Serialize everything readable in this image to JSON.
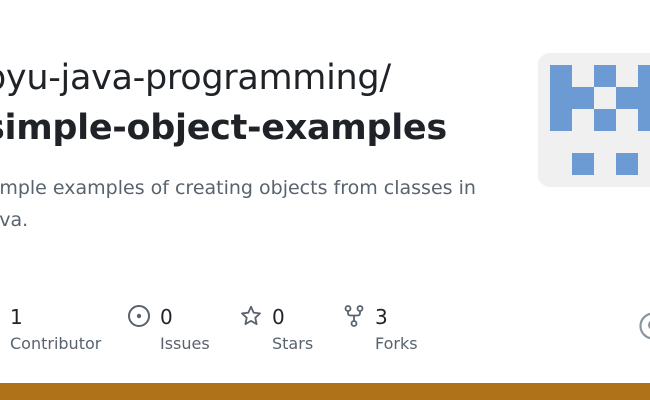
{
  "repo": {
    "owner_line": "byu-java-programming/",
    "name": "simple-object-examples",
    "description": "Simple examples of creating objects from classes in Java."
  },
  "stats": [
    {
      "value": "1",
      "label": "Contributor",
      "icon": "people-icon"
    },
    {
      "value": "0",
      "label": "Issues",
      "icon": "issue-icon"
    },
    {
      "value": "0",
      "label": "Stars",
      "icon": "star-icon"
    },
    {
      "value": "3",
      "label": "Forks",
      "icon": "fork-icon"
    }
  ],
  "colors": {
    "title": "#1f2328",
    "muted": "#59636e",
    "avatar_bg": "#f0f0f0",
    "avatar_blocks": "#6b9bd2",
    "bottom_bar": "#b07219"
  }
}
